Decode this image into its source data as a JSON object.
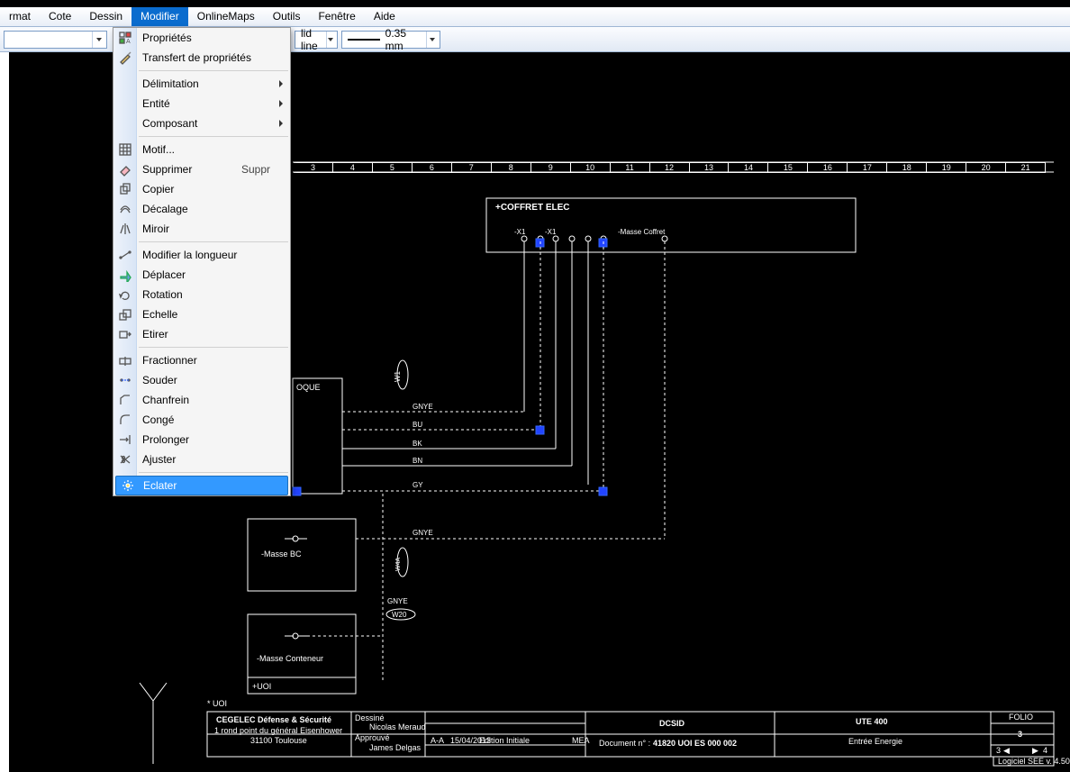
{
  "menubar": {
    "items": [
      "rmat",
      "Cote",
      "Dessin",
      "Modifier",
      "OnlineMaps",
      "Outils",
      "Fenêtre",
      "Aide"
    ],
    "active_index": 3
  },
  "toolbar": {
    "line_style_label": "lid line",
    "line_weight_label": "0.35 mm"
  },
  "menu_popup": {
    "groups": [
      {
        "items": [
          {
            "label": "Propriétés",
            "icon": "props"
          },
          {
            "label": "Transfert de propriétés",
            "icon": "brush"
          }
        ]
      },
      {
        "items": [
          {
            "label": "Délimitation",
            "sub": true
          },
          {
            "label": "Entité",
            "sub": true
          },
          {
            "label": "Composant",
            "sub": true
          }
        ]
      },
      {
        "items": [
          {
            "label": "Motif...",
            "icon": "hatch"
          },
          {
            "label": "Supprimer",
            "shortcut": "Suppr",
            "icon": "eraser"
          },
          {
            "label": "Copier",
            "icon": "copy"
          },
          {
            "label": "Décalage",
            "icon": "offset"
          },
          {
            "label": "Miroir",
            "icon": "mirror"
          }
        ]
      },
      {
        "items": [
          {
            "label": "Modifier la longueur",
            "icon": "len"
          },
          {
            "label": "Déplacer",
            "icon": "move"
          },
          {
            "label": "Rotation",
            "icon": "rot"
          },
          {
            "label": "Echelle",
            "icon": "scale"
          },
          {
            "label": "Etirer",
            "icon": "stretch"
          }
        ]
      },
      {
        "items": [
          {
            "label": "Fractionner",
            "icon": "split"
          },
          {
            "label": "Souder",
            "icon": "weld"
          },
          {
            "label": "Chanfrein",
            "icon": "chamfer"
          },
          {
            "label": "Congé",
            "icon": "fillet"
          },
          {
            "label": "Prolonger",
            "icon": "extend"
          },
          {
            "label": "Ajuster",
            "icon": "trim"
          }
        ]
      },
      {
        "items": [
          {
            "label": "Eclater",
            "icon": "explode",
            "highlight": true
          }
        ]
      }
    ]
  },
  "ruler_marks": [
    "3",
    "4",
    "5",
    "6",
    "7",
    "8",
    "9",
    "10",
    "11",
    "12",
    "13",
    "14",
    "15",
    "16",
    "17",
    "18",
    "19",
    "20",
    "21"
  ],
  "drawing": {
    "coffret_label": "+COFFRET ELEC",
    "x1a": "-X1",
    "x1b": "-X1",
    "masse_coffret": "-Masse Coffret",
    "w1": "W1",
    "w4a": "W4A",
    "w20": "W20",
    "oque": "OQUE",
    "gnye": "GNYE",
    "bu": "BU",
    "bk": "BK",
    "bn": "BN",
    "gy": "GY",
    "gnye2": "GNYE",
    "gnye3": "GNYE",
    "masse_bc": "-Masse BC",
    "masse_conteneur": "-Masse Conteneur",
    "uoi": "+UOI",
    "uoi_star": "* UOI"
  },
  "titleblock": {
    "company": "CEGELEC Défense & Sécurité",
    "addr1": "1 rond point du général Eisenhower",
    "addr2": "31100 Toulouse",
    "dessine": "Dessiné",
    "dessine_v": "Nicolas Meraud",
    "approuve": "Approuvé",
    "approuve_v": "James Delgas",
    "rev": "A-A",
    "date": "15/04/2013",
    "ed": "Edition Initiale",
    "mea": "MEA",
    "client": "DCSID",
    "doc_lbl": "Document n° :",
    "doc_no": "41820 UOI ES 000 002",
    "proj": "UTE 400",
    "sheet": "Entrée Energie",
    "folio_lbl": "FOLIO",
    "folio": "3",
    "pleft": "3",
    "pright": "4",
    "soft": "Logiciel SEE v. 4.50"
  }
}
